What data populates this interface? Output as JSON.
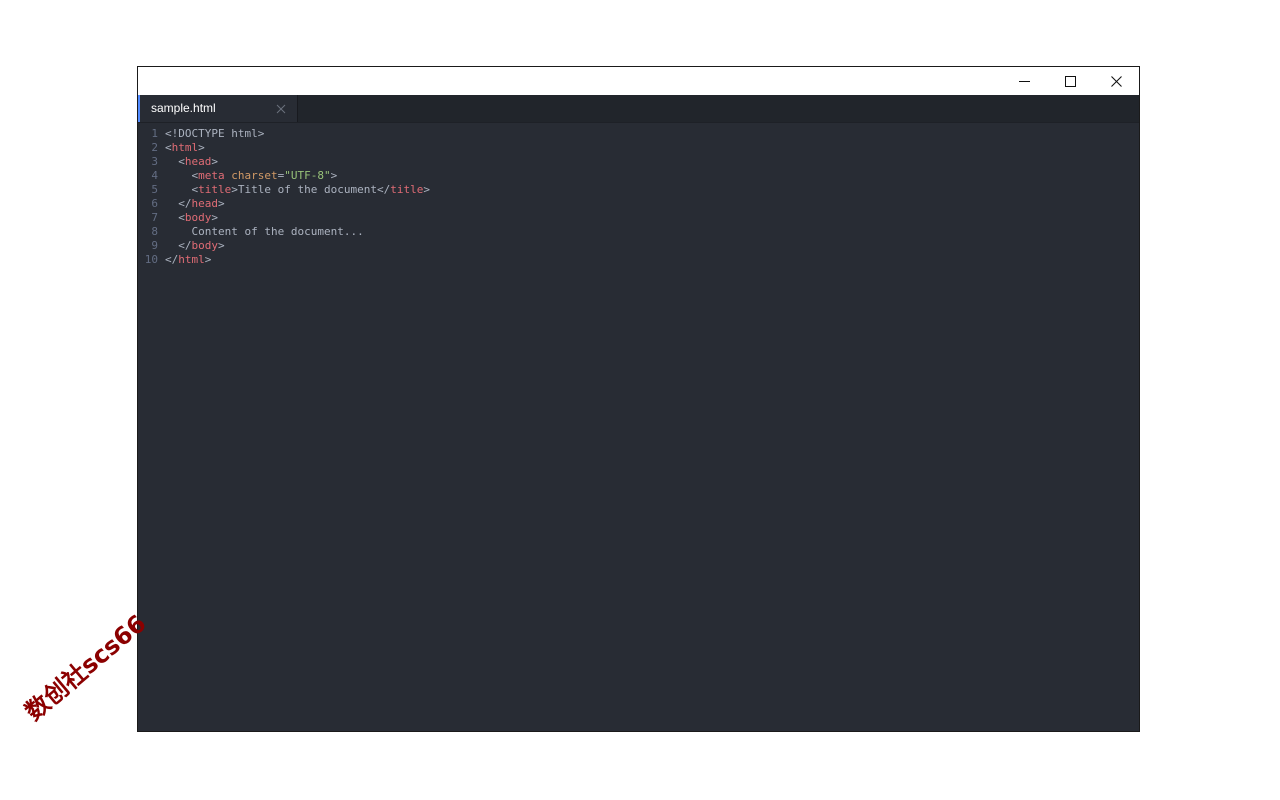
{
  "window": {
    "controls": [
      "minimize",
      "maximize",
      "close"
    ]
  },
  "tabs": [
    {
      "label": "sample.html",
      "active": true
    }
  ],
  "code_lines": [
    {
      "num": "1",
      "indent": "",
      "parts": [
        [
          "punc",
          "<!DOCTYPE html>"
        ]
      ]
    },
    {
      "num": "2",
      "indent": "",
      "parts": [
        [
          "punc",
          "<"
        ],
        [
          "tag",
          "html"
        ],
        [
          "punc",
          ">"
        ]
      ]
    },
    {
      "num": "3",
      "indent": "  ",
      "parts": [
        [
          "punc",
          "<"
        ],
        [
          "tag",
          "head"
        ],
        [
          "punc",
          ">"
        ]
      ]
    },
    {
      "num": "4",
      "indent": "    ",
      "parts": [
        [
          "punc",
          "<"
        ],
        [
          "tag",
          "meta"
        ],
        [
          "punc",
          " "
        ],
        [
          "attr",
          "charset"
        ],
        [
          "punc",
          "="
        ],
        [
          "str",
          "\"UTF-8\""
        ],
        [
          "punc",
          ">"
        ]
      ]
    },
    {
      "num": "5",
      "indent": "    ",
      "parts": [
        [
          "punc",
          "<"
        ],
        [
          "tag",
          "title"
        ],
        [
          "punc",
          ">Title of the document</"
        ],
        [
          "tag",
          "title"
        ],
        [
          "punc",
          ">"
        ]
      ]
    },
    {
      "num": "6",
      "indent": "  ",
      "parts": [
        [
          "punc",
          "</"
        ],
        [
          "tag",
          "head"
        ],
        [
          "punc",
          ">"
        ]
      ]
    },
    {
      "num": "7",
      "indent": "  ",
      "parts": [
        [
          "punc",
          "<"
        ],
        [
          "tag",
          "body"
        ],
        [
          "punc",
          ">"
        ]
      ]
    },
    {
      "num": "8",
      "indent": "    ",
      "parts": [
        [
          "punc",
          "Content of the document..."
        ]
      ]
    },
    {
      "num": "9",
      "indent": "  ",
      "parts": [
        [
          "punc",
          "</"
        ],
        [
          "tag",
          "body"
        ],
        [
          "punc",
          ">"
        ]
      ]
    },
    {
      "num": "10",
      "indent": "",
      "parts": [
        [
          "punc",
          "</"
        ],
        [
          "tag",
          "html"
        ],
        [
          "punc",
          ">"
        ]
      ]
    }
  ],
  "watermark": "数创社scs66",
  "colors": {
    "editor_bg": "#282c34",
    "tag": "#e06c75",
    "attr": "#d19a66",
    "string": "#98c379",
    "text": "#abb2bf",
    "line_number": "#636d83",
    "tab_accent": "#528bff"
  }
}
